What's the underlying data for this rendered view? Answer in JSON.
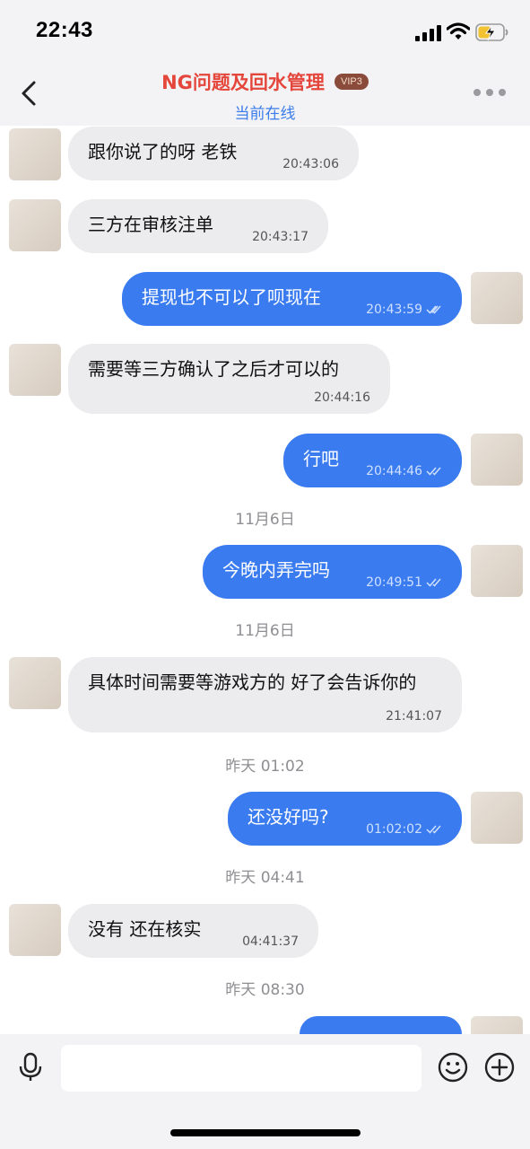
{
  "status_bar": {
    "time": "22:43"
  },
  "header": {
    "title": "NG问题及回水管理",
    "vip_badge": "VIP3",
    "online_status": "当前在线"
  },
  "messages": [
    {
      "text": "跟你说了的呀  老铁",
      "time": "20:43:06",
      "direction": "in"
    },
    {
      "text": "三方在审核注单",
      "time": "20:43:17",
      "direction": "in"
    },
    {
      "text": "提现也不可以了呗现在",
      "time": "20:43:59",
      "direction": "out"
    },
    {
      "text": "需要等三方确认了之后才可以的",
      "time": "20:44:16",
      "direction": "in"
    },
    {
      "text": "行吧",
      "time": "20:44:46",
      "direction": "out"
    },
    {
      "text": "今晚内弄完吗",
      "time": "20:49:51",
      "direction": "out"
    },
    {
      "text": "具体时间需要等游戏方的  好了会告诉你的",
      "time": "21:41:07",
      "direction": "in"
    },
    {
      "text": "还没好吗?",
      "time": "01:02:02",
      "direction": "out"
    },
    {
      "text": "没有  还在核实",
      "time": "04:41:37",
      "direction": "in"
    }
  ],
  "separators": [
    "11月6日",
    "11月6日",
    "昨天 01:02",
    "昨天 04:41",
    "昨天 08:30"
  ],
  "composer": {
    "placeholder": ""
  },
  "colors": {
    "title": "#e5463b",
    "accent": "#3a7bf0",
    "incoming_bubble": "#ececee"
  },
  "icons": [
    "back-chevron-icon",
    "more-dots-icon",
    "microphone-icon",
    "emoji-icon",
    "plus-icon",
    "double-check-icon"
  ]
}
